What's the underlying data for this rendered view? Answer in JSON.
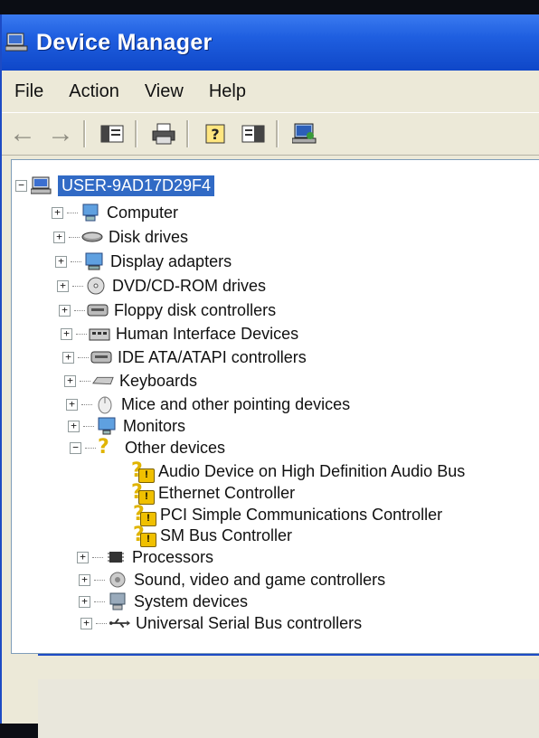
{
  "window": {
    "title": "Device Manager"
  },
  "menu": [
    "File",
    "Action",
    "View",
    "Help"
  ],
  "toolbar": {
    "buttons": [
      "back-icon",
      "forward-icon",
      "show-hide-tree-icon",
      "print-icon",
      "help-icon",
      "properties-icon",
      "scan-hardware-icon"
    ]
  },
  "tree": {
    "root": "USER-9AD17D29F4",
    "categories": [
      "Computer",
      "Disk drives",
      "Display adapters",
      "DVD/CD-ROM drives",
      "Floppy disk controllers",
      "Human Interface Devices",
      "IDE ATA/ATAPI controllers",
      "Keyboards",
      "Mice and other pointing devices",
      "Monitors",
      "Other devices",
      "Processors",
      "Sound, video and game controllers",
      "System devices",
      "Universal Serial Bus controllers"
    ],
    "other_devices": [
      "Audio Device on High Definition Audio Bus",
      "Ethernet Controller",
      "PCI Simple Communications Controller",
      "SM Bus Controller"
    ]
  }
}
